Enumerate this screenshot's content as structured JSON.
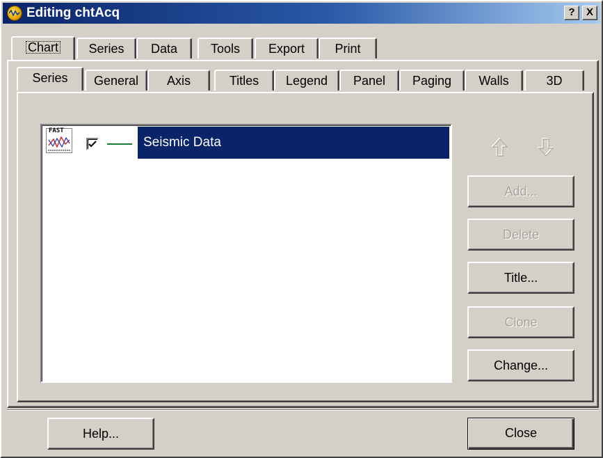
{
  "window": {
    "title": "Editing chtAcq",
    "help_glyph": "?",
    "close_glyph": "X"
  },
  "outer_tabs": [
    "Chart",
    "Series",
    "Data",
    "Tools",
    "Export",
    "Print"
  ],
  "inner_tabs": [
    "Series",
    "General",
    "Axis",
    "Titles",
    "Legend",
    "Panel",
    "Paging",
    "Walls",
    "3D"
  ],
  "series_list": {
    "items": [
      {
        "icon_label": "FAST",
        "checked": true,
        "line_color": "#1a7a3a",
        "name": "Seismic Data",
        "selected": true
      }
    ]
  },
  "side_buttons": {
    "move_up": "up-arrow-icon",
    "move_down": "down-arrow-icon",
    "add": "Add...",
    "delete": "Delete",
    "title": "Title...",
    "clone": "Clone",
    "change": "Change..."
  },
  "footer": {
    "help": "Help...",
    "close": "Close"
  },
  "colors": {
    "titlebar": "#0a246a",
    "selection": "#0a246a",
    "face": "#d4d0c8"
  }
}
